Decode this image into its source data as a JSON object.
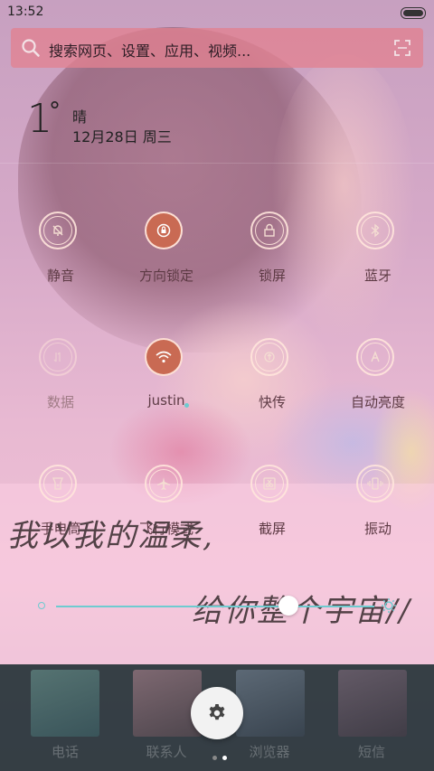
{
  "status_bar": {
    "time": "13:52"
  },
  "search": {
    "placeholder": "搜索网页、设置、应用、视频..."
  },
  "weather": {
    "temperature": "1",
    "degree_symbol": "°",
    "condition": "晴",
    "date": "12月28日 周三"
  },
  "toggles": [
    {
      "label": "静音",
      "icon": "bell-mute-icon",
      "active": false
    },
    {
      "label": "方向锁定",
      "icon": "rotation-lock-icon",
      "active": true
    },
    {
      "label": "锁屏",
      "icon": "lock-icon",
      "active": false
    },
    {
      "label": "蓝牙",
      "icon": "bluetooth-icon",
      "active": false
    },
    {
      "label": "数据",
      "icon": "mobile-data-icon",
      "active": false,
      "dimmed": true
    },
    {
      "label": "justin",
      "icon": "wifi-icon",
      "active": true
    },
    {
      "label": "快传",
      "icon": "quick-transfer-icon",
      "active": false
    },
    {
      "label": "自动亮度",
      "icon": "auto-brightness-icon",
      "active": false
    },
    {
      "label": "手电筒",
      "icon": "flashlight-icon",
      "active": false
    },
    {
      "label": "飞行模式",
      "icon": "airplane-icon",
      "active": false
    },
    {
      "label": "截屏",
      "icon": "screenshot-icon",
      "active": false
    },
    {
      "label": "振动",
      "icon": "vibrate-icon",
      "active": false
    }
  ],
  "wallpaper_text": {
    "line1": "我以我的温柔,",
    "line2": "给你整个宇宙//"
  },
  "brightness": {
    "level": 0.73,
    "accent": "#6ecbd0"
  },
  "dock": {
    "apps": [
      "电话",
      "联系人",
      "浏览器",
      "短信"
    ]
  },
  "pager": {
    "pages": 2,
    "current": 2
  },
  "colors": {
    "active_toggle": "#c96a53",
    "search_bg": "#e18291",
    "label_text": "#5d3a44"
  }
}
